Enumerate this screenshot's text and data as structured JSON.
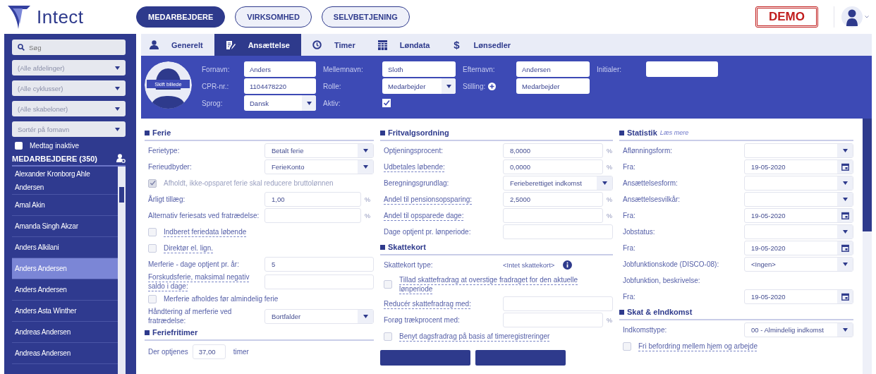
{
  "brand": "Intect",
  "nav": [
    {
      "label": "MEDARBEJDERE",
      "selected": true
    },
    {
      "label": "VIRKSOMHED",
      "selected": false
    },
    {
      "label": "SELVBETJENING",
      "selected": false
    }
  ],
  "demo_badge": "DEMO",
  "sidebar": {
    "search": {
      "placeholder": "Søg"
    },
    "filters": [
      "(Alle afdelinger)",
      "(Alle cyklusser)",
      "(Alle skabeloner)",
      "Sortér på fornavn"
    ],
    "include_inactive": {
      "label": "Medtag inaktive",
      "checked": false
    },
    "list_title": "MEDARBEJDERE (350)",
    "employees": [
      {
        "name": "Alexander Kronborg Ahle Andersen",
        "selected": false
      },
      {
        "name": "Amal Akin",
        "selected": false
      },
      {
        "name": "Amanda Singh Akzar",
        "selected": false
      },
      {
        "name": "Anders Alkilani",
        "selected": false
      },
      {
        "name": "Anders Andersen",
        "selected": true
      },
      {
        "name": "Anders Andersen",
        "selected": false
      },
      {
        "name": "Anders Asta Winther",
        "selected": false
      },
      {
        "name": "Andreas Andersen",
        "selected": false
      },
      {
        "name": "Andreas Andersen",
        "selected": false
      }
    ]
  },
  "tabs": [
    {
      "label": "Generelt",
      "selected": false
    },
    {
      "label": "Ansættelse",
      "selected": true
    },
    {
      "label": "Timer",
      "selected": false
    },
    {
      "label": "Løndata",
      "selected": false
    },
    {
      "label": "Lønsedler",
      "glyph": "$",
      "selected": false
    }
  ],
  "profile": {
    "photo_button": "Skift billede",
    "rows": [
      [
        {
          "label": "Fornavn:",
          "kind": "input",
          "value": "Anders"
        },
        {
          "label": "Mellemnavn:",
          "kind": "input",
          "value": "Sloth"
        },
        {
          "label": "Efternavn:",
          "kind": "input",
          "value": "Andersen"
        },
        {
          "label": "Initialer:",
          "kind": "input"
        }
      ],
      [
        {
          "label": "CPR-nr.:",
          "kind": "input",
          "value": "1104478220"
        },
        {
          "label": "Rolle:",
          "kind": "select",
          "value": "Medarbejder"
        },
        {
          "label": "Stilling:",
          "kind": "input",
          "value": "Medarbejder",
          "add_button": true
        }
      ],
      [
        {
          "label": "Sprog:",
          "kind": "select",
          "value": "Dansk"
        },
        {
          "label": "Aktiv:",
          "kind": "checkbox",
          "checked": true
        }
      ]
    ]
  },
  "columns": [
    [
      {
        "title": "Ferie",
        "rows": [
          {
            "kind": "select",
            "label": "Ferietype:",
            "value": "Betalt ferie"
          },
          {
            "kind": "select",
            "label": "Ferieudbyder:",
            "value": "FerieKonto"
          },
          {
            "kind": "checkbox",
            "label": "Afholdt, ikke-opsparet ferie skal reducere bruttolønnen",
            "checked": true,
            "disabled": true,
            "underlined": false
          },
          {
            "kind": "input",
            "label": "Årligt tillæg:",
            "value": "1,00",
            "unit": "%",
            "underlined": false
          },
          {
            "kind": "input",
            "label": "Alternativ feriesats ved fratrædelse:",
            "value": "",
            "unit": "%",
            "underlined": false
          },
          {
            "kind": "checkbox",
            "label": "Indberet feriedata løbende",
            "checked": false,
            "disabled": false,
            "underlined": true
          },
          {
            "kind": "checkbox",
            "label": "Direktør el. lign.",
            "checked": false,
            "disabled": false,
            "underlined": true
          },
          {
            "kind": "input",
            "label": "Merferie - dage optjent pr. år:",
            "value": "5",
            "underlined": false
          },
          {
            "kind": "input",
            "label": "Forskudsferie, maksimal negativ saldo i dage:",
            "value": "",
            "underlined": true
          },
          {
            "kind": "checkbox",
            "label": "Merferie afholdes før almindelig ferie",
            "checked": false,
            "disabled": false,
            "underlined": false
          },
          {
            "kind": "select",
            "label": "Håndtering af merferie ved fratrædelse:",
            "value": "Bortfalder"
          }
        ]
      },
      {
        "title": "Feriefritimer",
        "rows": [
          {
            "kind": "inline",
            "label": "Der optjenes",
            "value": "37,00",
            "unit": "timer"
          }
        ]
      }
    ],
    [
      {
        "title": "Fritvalgsordning",
        "rows": [
          {
            "kind": "input",
            "label": "Optjeningsprocent:",
            "value": "8,0000",
            "unit": "%",
            "underlined": false
          },
          {
            "kind": "input",
            "label": "Udbetales løbende:",
            "value": "0,0000",
            "unit": "%",
            "underlined": true
          },
          {
            "kind": "select",
            "label": "Beregningsgrundlag:",
            "value": "Ferieberettiget indkomst"
          },
          {
            "kind": "input",
            "label": "Andel til pensionsopsparing:",
            "value": "2,5000",
            "unit": "%",
            "underlined": true
          },
          {
            "kind": "input",
            "label": "Andel til opsparede dage:",
            "value": "",
            "unit": "%",
            "underlined": true
          },
          {
            "kind": "input",
            "label": "Dage optjent pr. lønperiode:",
            "value": "",
            "underlined": false
          }
        ]
      },
      {
        "title": "Skattekort",
        "rows": [
          {
            "kind": "text",
            "label": "Skattekort type:",
            "value": "<Intet skattekort>",
            "info": true
          },
          {
            "kind": "checkbox",
            "label": "Tillad skattefradrag at overstige fradraget for den aktuelle lønperiode",
            "checked": false,
            "disabled": false,
            "underlined": true
          },
          {
            "kind": "input",
            "label": "Reducér skattefradrag med:",
            "value": "",
            "underlined": true
          },
          {
            "kind": "input",
            "label": "Forøg trækprocent med:",
            "value": "",
            "unit": "%",
            "underlined": false
          },
          {
            "kind": "checkbox",
            "label": "Benyt dagsfradrag på basis af timeregistreringer",
            "checked": false,
            "disabled": false,
            "underlined": true
          }
        ]
      }
    ],
    [
      {
        "title": "Statistik",
        "link": "Læs mere",
        "rows": [
          {
            "kind": "select",
            "label": "Aflønningsform:",
            "value": ""
          },
          {
            "kind": "date",
            "label": "Fra:",
            "value": "19-05-2020"
          },
          {
            "kind": "select",
            "label": "Ansættelsesform:",
            "value": ""
          },
          {
            "kind": "select",
            "label": "Ansættelsesvilkår:",
            "value": ""
          },
          {
            "kind": "date",
            "label": "Fra:",
            "value": "19-05-2020"
          },
          {
            "kind": "select",
            "label": "Jobstatus:",
            "value": ""
          },
          {
            "kind": "date",
            "label": "Fra:",
            "value": "19-05-2020"
          },
          {
            "kind": "select",
            "label": "Jobfunktionskode (DISCO-08):",
            "value": "<Ingen>"
          },
          {
            "kind": "label",
            "label": "Jobfunktion, beskrivelse:"
          },
          {
            "kind": "date",
            "label": "Fra:",
            "value": "19-05-2020"
          }
        ]
      },
      {
        "title": "Skat & eIndkomst",
        "rows": [
          {
            "kind": "select",
            "label": "Indkomsttype:",
            "value": "00 - Almindelig indkomst"
          },
          {
            "kind": "checkbox",
            "label": "Fri befordring mellem hjem og arbejde",
            "checked": false,
            "disabled": false,
            "underlined": true
          }
        ]
      }
    ]
  ]
}
